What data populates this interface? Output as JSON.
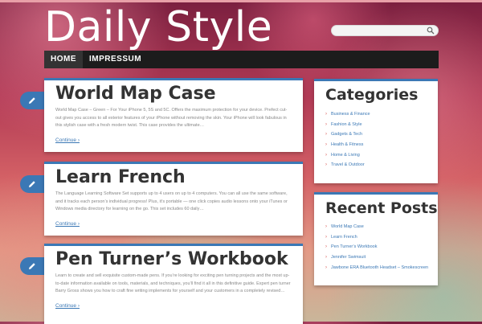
{
  "site": {
    "title": "Daily Style"
  },
  "search": {
    "placeholder": "",
    "value": ""
  },
  "nav": {
    "items": [
      {
        "label": "HOME"
      },
      {
        "label": "IMPRESSUM"
      }
    ]
  },
  "posts": [
    {
      "title": "World Map Case",
      "excerpt": "World Map Case – Green – For Your iPhone 5, 5S and 5C. Offers the maximum protection for your device. Prefect cut-out gives you access to all exterior features of your iPhone without removing the skin. Your iPhone will look fabulous in this stylish case with a fresh modern twist. This case provides the ultimate…",
      "more": "Continue ›"
    },
    {
      "title": "Learn French",
      "excerpt": "The Language Learning Software Set supports up to 4 users on up to 4 computers. You can all use the same software, and it tracks each person’s individual progress! Plus, it’s portable — one click copies audio lessons onto your iTunes or Windows media directory for learning on the go. This set includes 60 daily…",
      "more": "Continue ›"
    },
    {
      "title": "Pen Turner’s Workbook",
      "excerpt": "Learn to create and sell exquisite custom-made pens. If you’re looking for exciting pen turning projects and the most up-to-date information available on tools, materials, and techniques, you’ll find it all in this definitive guide. Expert pen turner Barry Gross shows you how to craft fine writing implements for yourself and your customers in a completely revised…",
      "more": "Continue ›"
    }
  ],
  "categories": {
    "title": "Categories",
    "items": [
      {
        "label": "Business & Finance"
      },
      {
        "label": "Fashion & Style"
      },
      {
        "label": "Gadgets & Tech"
      },
      {
        "label": "Health & Fitness"
      },
      {
        "label": "Home & Living"
      },
      {
        "label": "Travel & Outdoor"
      }
    ]
  },
  "recent": {
    "title": "Recent Posts",
    "items": [
      {
        "label": "World Map Case"
      },
      {
        "label": "Learn French"
      },
      {
        "label": "Pen Turner’s Workbook"
      },
      {
        "label": "Jennifer Swimsuit"
      },
      {
        "label": "Jawbone ERA Bluetooth Headset – Smokescreen"
      }
    ]
  },
  "icons": {
    "search": "search-icon",
    "edit": "pencil-icon",
    "bullet": "chevron-right-icon"
  },
  "colors": {
    "accent": "#3b78b5",
    "navbar": "#1c1c1c",
    "bullet": "#d9534f"
  }
}
